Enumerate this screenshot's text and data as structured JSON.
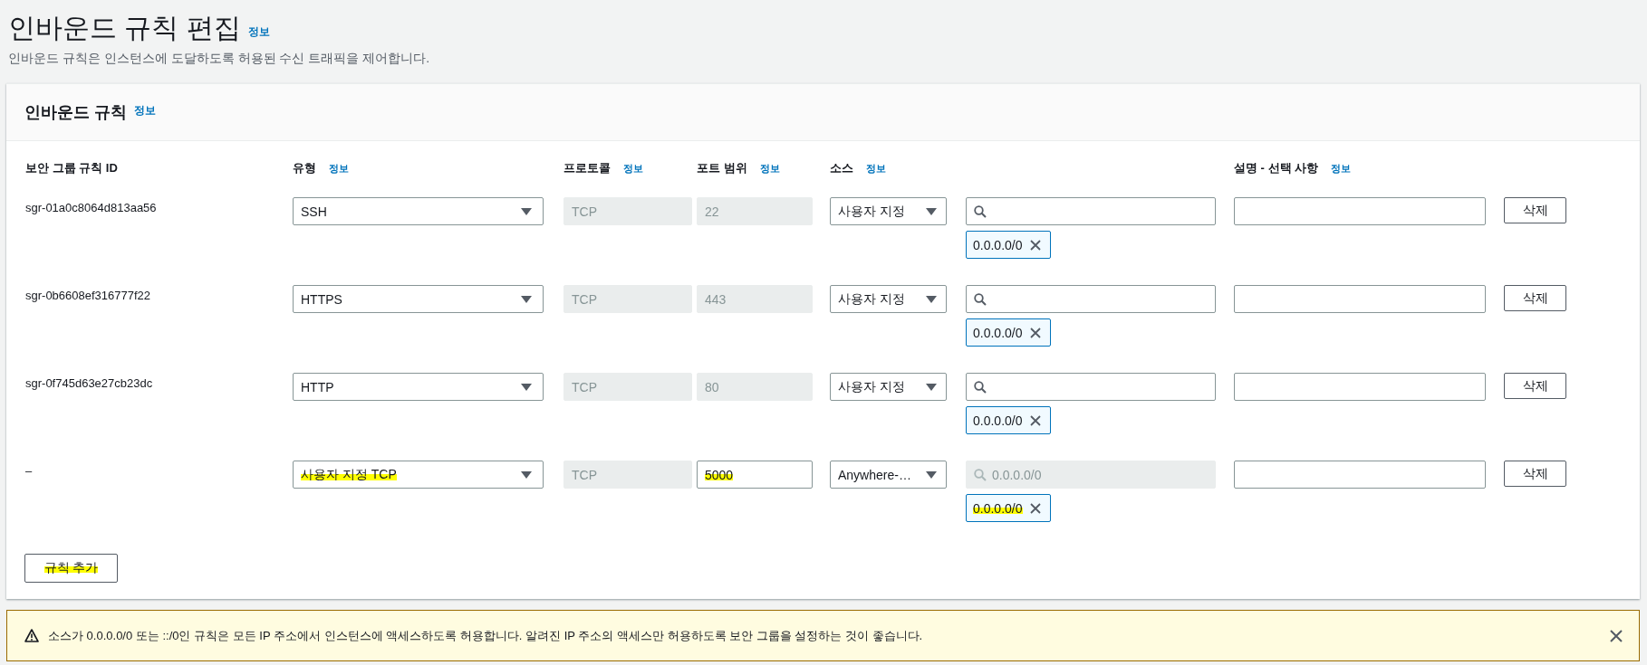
{
  "page": {
    "title": "인바운드 규칙 편집",
    "title_info": "정보",
    "description": "인바운드 규칙은 인스턴스에 도달하도록 허용된 수신 트래픽을 제어합니다."
  },
  "panel": {
    "title": "인바운드 규칙",
    "title_info": "정보",
    "columns": [
      {
        "label": "보안 그룹 규칙 ID"
      },
      {
        "label": "유형",
        "info": "정보"
      },
      {
        "label": "프로토콜",
        "info": "정보"
      },
      {
        "label": "포트 범위",
        "info": "정보"
      },
      {
        "label": "소스",
        "info": "정보"
      },
      {
        "label": "설명 - 선택 사항",
        "info": "정보"
      }
    ],
    "rows": [
      {
        "id": "sgr-01a0c8064d813aa56",
        "type": {
          "value": "SSH",
          "highlighted": false
        },
        "protocol": "TCP",
        "port": {
          "value": "22",
          "disabled": true,
          "highlighted": false
        },
        "source": "사용자 지정",
        "search": {
          "disabled": false
        },
        "chip": {
          "label": "0.0.0.0/0",
          "highlighted": false
        },
        "delete": "삭제"
      },
      {
        "id": "sgr-0b6608ef316777f22",
        "type": {
          "value": "HTTPS",
          "highlighted": false
        },
        "protocol": "TCP",
        "port": {
          "value": "443",
          "disabled": true,
          "highlighted": false
        },
        "source": "사용자 지정",
        "search": {
          "disabled": false
        },
        "chip": {
          "label": "0.0.0.0/0",
          "highlighted": false
        },
        "delete": "삭제"
      },
      {
        "id": "sgr-0f745d63e27cb23dc",
        "type": {
          "value": "HTTP",
          "highlighted": false
        },
        "protocol": "TCP",
        "port": {
          "value": "80",
          "disabled": true,
          "highlighted": false
        },
        "source": "사용자 지정",
        "search": {
          "disabled": false
        },
        "chip": {
          "label": "0.0.0.0/0",
          "highlighted": false
        },
        "delete": "삭제"
      },
      {
        "id": "–",
        "type": {
          "value": "사용자 지정 TCP",
          "highlighted": true
        },
        "protocol": "TCP",
        "port": {
          "value": "5000",
          "disabled": false,
          "highlighted": true
        },
        "source": "Anywhere-…",
        "search": {
          "disabled": true,
          "placeholder": "0.0.0.0/0"
        },
        "chip": {
          "label": "0.0.0.0/0",
          "highlighted": true
        },
        "delete": "삭제"
      }
    ],
    "add_button": {
      "label": "규칙 추가",
      "highlighted": true
    }
  },
  "warning": {
    "text": "소스가 0.0.0.0/0 또는 ::/0인 규칙은 모든 IP 주소에서 인스턴스에 액세스하도록 허용합니다. 알려진 IP 주소의 액세스만 허용하도록 보안 그룹을 설정하는 것이 좋습니다."
  }
}
